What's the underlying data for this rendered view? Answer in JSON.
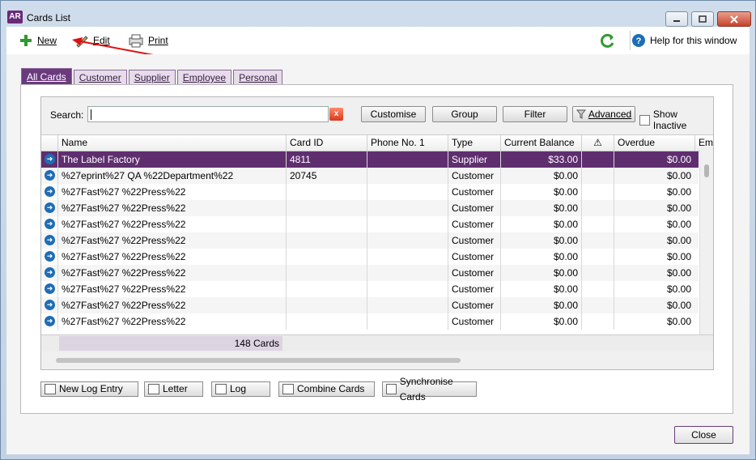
{
  "window": {
    "app_badge": "AR",
    "title": "Cards List"
  },
  "toolbar": {
    "new_label": "New",
    "edit_label": "Edit",
    "print_label": "Print",
    "help_label": "Help for this window"
  },
  "tabs": [
    "All Cards",
    "Customer",
    "Supplier",
    "Employee",
    "Personal"
  ],
  "search": {
    "label": "Search:",
    "value": "",
    "clear_glyph": "x"
  },
  "buttons": {
    "customise": "Customise",
    "group": "Group",
    "filter": "Filter",
    "advanced": "Advanced",
    "show_inactive": "Show Inactive"
  },
  "columns": [
    "Name",
    "Card ID",
    "Phone No. 1",
    "Type",
    "Current Balance",
    "⚠",
    "Overdue",
    "Ema"
  ],
  "rows": [
    {
      "name": "The Label Factory",
      "card_id": "4811",
      "phone": "",
      "type": "Supplier",
      "balance": "$33.00",
      "overdue": "$0.00",
      "selected": true
    },
    {
      "name": "%27eprint%27 QA %22Department%22",
      "card_id": "20745",
      "phone": "",
      "type": "Customer",
      "balance": "$0.00",
      "overdue": "$0.00"
    },
    {
      "name": "%27Fast%27 %22Press%22",
      "card_id": "",
      "phone": "",
      "type": "Customer",
      "balance": "$0.00",
      "overdue": "$0.00"
    },
    {
      "name": "%27Fast%27 %22Press%22",
      "card_id": "",
      "phone": "",
      "type": "Customer",
      "balance": "$0.00",
      "overdue": "$0.00"
    },
    {
      "name": "%27Fast%27 %22Press%22",
      "card_id": "",
      "phone": "",
      "type": "Customer",
      "balance": "$0.00",
      "overdue": "$0.00"
    },
    {
      "name": "%27Fast%27 %22Press%22",
      "card_id": "",
      "phone": "",
      "type": "Customer",
      "balance": "$0.00",
      "overdue": "$0.00"
    },
    {
      "name": "%27Fast%27 %22Press%22",
      "card_id": "",
      "phone": "",
      "type": "Customer",
      "balance": "$0.00",
      "overdue": "$0.00"
    },
    {
      "name": "%27Fast%27 %22Press%22",
      "card_id": "",
      "phone": "",
      "type": "Customer",
      "balance": "$0.00",
      "overdue": "$0.00"
    },
    {
      "name": "%27Fast%27 %22Press%22",
      "card_id": "",
      "phone": "",
      "type": "Customer",
      "balance": "$0.00",
      "overdue": "$0.00"
    },
    {
      "name": "%27Fast%27 %22Press%22",
      "card_id": "",
      "phone": "",
      "type": "Customer",
      "balance": "$0.00",
      "overdue": "$0.00"
    },
    {
      "name": "%27Fast%27 %22Press%22",
      "card_id": "",
      "phone": "",
      "type": "Customer",
      "balance": "$0.00",
      "overdue": "$0.00"
    }
  ],
  "footer": {
    "count": "148 Cards"
  },
  "bottom_buttons": [
    "New Log Entry",
    "Letter",
    "Log",
    "Combine Cards",
    "Synchronise Cards"
  ],
  "close_label": "Close",
  "colors": {
    "accent": "#5f2e6f",
    "tab_active": "#6b3a7d",
    "annotation_arrow": "#e01010"
  }
}
